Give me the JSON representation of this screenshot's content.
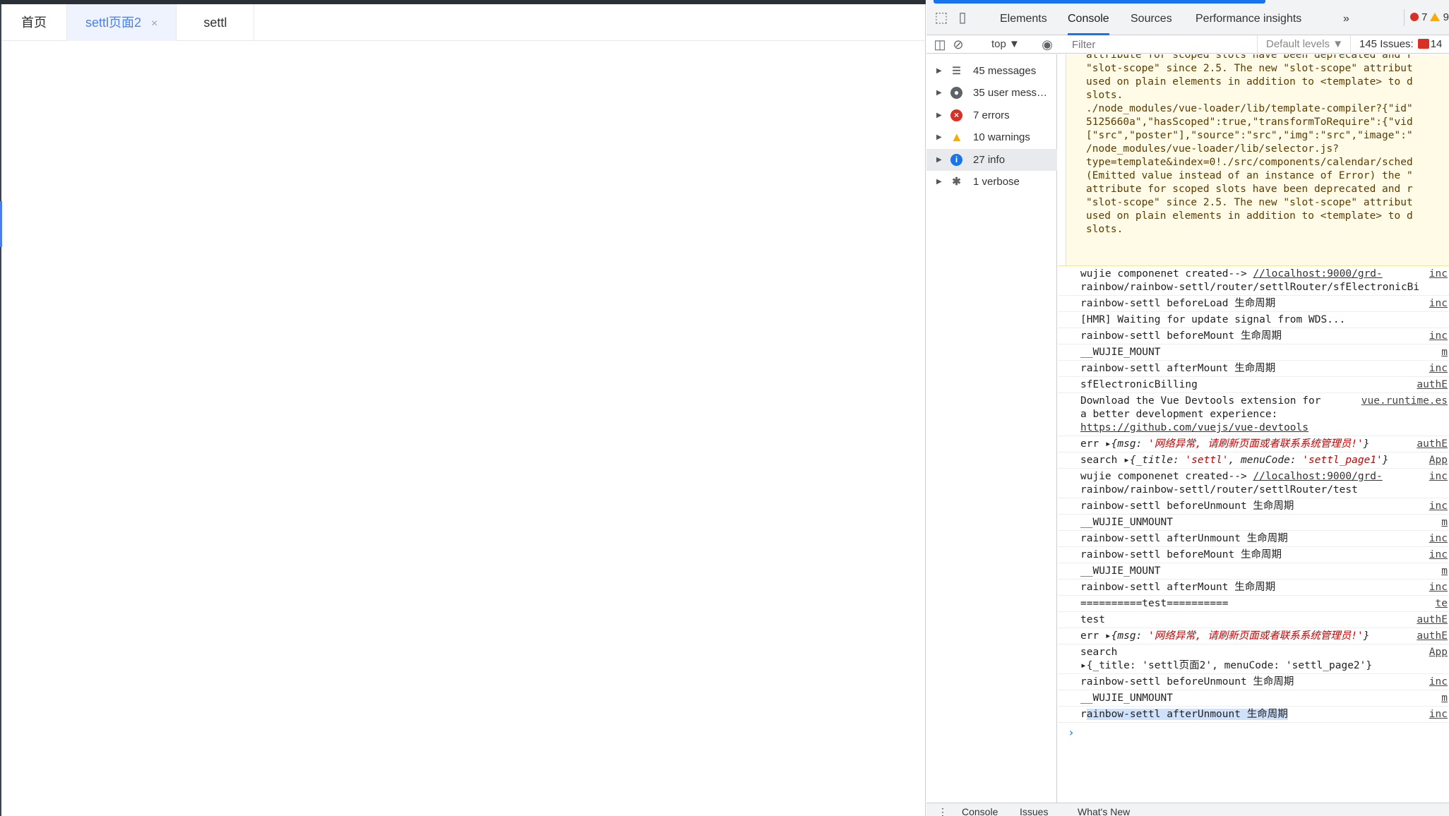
{
  "app": {
    "tabs": [
      {
        "label": "首页"
      },
      {
        "label": "settl页面2",
        "close": "×"
      },
      {
        "label": "settl"
      }
    ]
  },
  "devtools": {
    "tabs": [
      "Elements",
      "Console",
      "Sources",
      "Performance insights"
    ],
    "more": "»",
    "error_count": "7",
    "warning_count": "9",
    "toolbar": {
      "context": "top ▼",
      "filter_placeholder": "Filter",
      "levels": "Default levels ▼",
      "issues": "145 Issues:",
      "issues_count": "14"
    },
    "sidebar": [
      {
        "label": "45 messages",
        "icon": "list-icon"
      },
      {
        "label": "35 user mess…",
        "icon": "user-icon"
      },
      {
        "label": "7 errors",
        "icon": "error-icon"
      },
      {
        "label": "10 warnings",
        "icon": "warning-icon"
      },
      {
        "label": "27 info",
        "icon": "info-icon"
      },
      {
        "label": "1 verbose",
        "icon": "bug-icon"
      }
    ],
    "warning_text": [
      "attribute for scoped slots have been deprecated and r",
      "\"slot-scope\" since 2.5. The new \"slot-scope\" attribut",
      "used on plain elements in addition to <template> to d",
      "slots.",
      "./node_modules/vue-loader/lib/template-compiler?{\"id\"",
      "5125660a\",\"hasScoped\":true,\"transformToRequire\":{\"vid",
      "[\"src\",\"poster\"],\"source\":\"src\",\"img\":\"src\",\"image\":\"",
      "/node_modules/vue-loader/lib/selector.js?",
      "type=template&index=0!./src/components/calendar/sched",
      "(Emitted value instead of an instance of Error) the \"",
      "attribute for scoped slots have been deprecated and r",
      "\"slot-scope\" since 2.5. The new \"slot-scope\" attribut",
      "used on plain elements in addition to <template> to d",
      "slots."
    ],
    "logs": [
      {
        "text": "wujie componenet created--> ",
        "link": "//localhost:9000/grd-",
        "line2": "rainbow/rainbow-settl/router/settlRouter/sfElectronicBi",
        "src": "inc"
      },
      {
        "text": "rainbow-settl beforeLoad 生命周期",
        "src": "inc"
      },
      {
        "text": "[HMR] Waiting for update signal from WDS...",
        "src": ""
      },
      {
        "text": "rainbow-settl beforeMount 生命周期",
        "src": "inc"
      },
      {
        "text": "__WUJIE_MOUNT",
        "src": "m"
      },
      {
        "text": "rainbow-settl afterMount 生命周期",
        "src": "inc"
      },
      {
        "text": "sfElectronicBilling",
        "src": "authE"
      },
      {
        "text": "Download the Vue Devtools extension for",
        "line2": "a better development experience:",
        "line3": "https://github.com/vuejs/vue-devtools",
        "src": "vue.runtime.es"
      },
      {
        "text": "err ▸",
        "obj": "{msg: ",
        "red": "'网络异常, 请刷新页面或者联系系统管理员!'",
        "tail": "}",
        "src": "authE"
      },
      {
        "text": "search ▸",
        "obj": "{_title: ",
        "red": "'settl'",
        "mid": ", menuCode: ",
        "red2": "'settl_page1'",
        "tail": "}",
        "src": "App"
      },
      {
        "text": "wujie componenet created--> ",
        "link": "//localhost:9000/grd-",
        "line2": "rainbow/rainbow-settl/router/settlRouter/test",
        "src": "inc"
      },
      {
        "text": "rainbow-settl beforeUnmount 生命周期",
        "src": "inc"
      },
      {
        "text": "__WUJIE_UNMOUNT",
        "src": "m"
      },
      {
        "text": "rainbow-settl afterUnmount 生命周期",
        "src": "inc"
      },
      {
        "text": "rainbow-settl beforeMount 生命周期",
        "src": "inc"
      },
      {
        "text": "__WUJIE_MOUNT",
        "src": "m"
      },
      {
        "text": "rainbow-settl afterMount 生命周期",
        "src": "inc"
      },
      {
        "text": "==========test==========",
        "src": "te"
      },
      {
        "text": "test",
        "src": "authE"
      },
      {
        "text": "err ▸",
        "obj": "{msg: ",
        "red": "'网络异常, 请刷新页面或者联系系统管理员!'",
        "tail": "}",
        "src": "authE"
      },
      {
        "text": "search",
        "line2": "▸{_title: 'settl页面2', menuCode: 'settl_page2'}",
        "src": "App"
      },
      {
        "text": "rainbow-settl beforeUnmount 生命周期",
        "src": "inc"
      },
      {
        "text": "__WUJIE_UNMOUNT",
        "src": "m"
      },
      {
        "text": "rainbow-settl afterUnmount 生命周期",
        "src": "inc"
      }
    ],
    "prompt": "›",
    "drawer": [
      "Console",
      "Issues",
      "What's New"
    ]
  }
}
